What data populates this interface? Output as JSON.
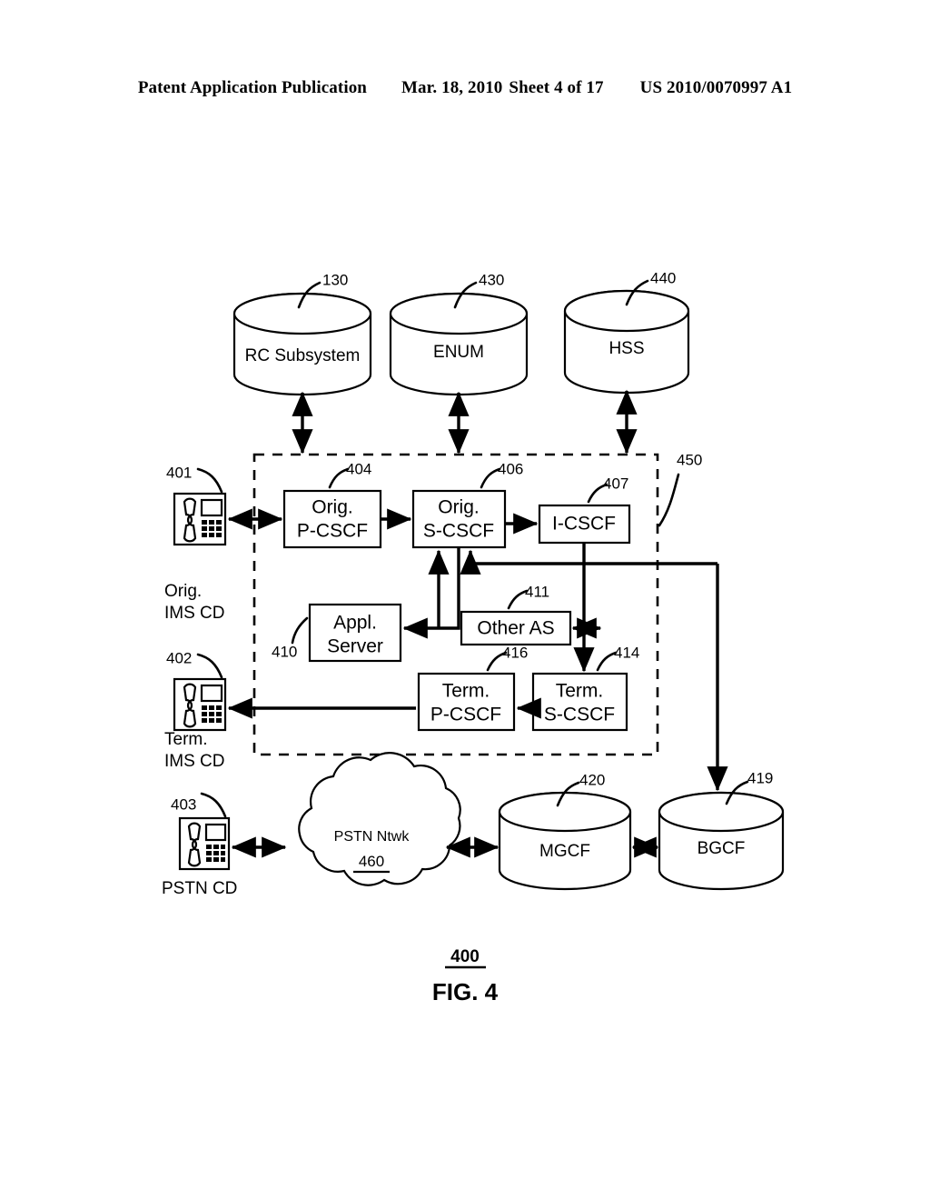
{
  "header": {
    "publication": "Patent Application Publication",
    "date": "Mar. 18, 2010",
    "sheet": "Sheet 4 of 17",
    "number": "US 2010/0070997 A1"
  },
  "figure": {
    "caption": "FIG. 4",
    "figure_ref": "400"
  },
  "databases": [
    {
      "label": "RC Subsystem",
      "ref": "130"
    },
    {
      "label": "ENUM",
      "ref": "430"
    },
    {
      "label": "HSS",
      "ref": "440"
    }
  ],
  "ims_boundary": {
    "ref": "450"
  },
  "nodes": [
    {
      "id": "orig-p-cscf",
      "line1": "Orig.",
      "line2": "P-CSCF",
      "ref": "404"
    },
    {
      "id": "orig-s-cscf",
      "line1": "Orig.",
      "line2": "S-CSCF",
      "ref": "406"
    },
    {
      "id": "i-cscf",
      "line1": "I-CSCF",
      "line2": "",
      "ref": "407"
    },
    {
      "id": "appl-server",
      "line1": "Appl.",
      "line2": "Server",
      "ref": "410"
    },
    {
      "id": "other-as",
      "line1": "Other AS",
      "line2": "",
      "ref": "411"
    },
    {
      "id": "term-p-cscf",
      "line1": "Term.",
      "line2": "P-CSCF",
      "ref": "416"
    },
    {
      "id": "term-s-cscf",
      "line1": "Term.",
      "line2": "S-CSCF",
      "ref": "414"
    }
  ],
  "endpoints": [
    {
      "id": "orig-ims-cd",
      "ref": "401",
      "label_line1": "Orig.",
      "label_line2": "IMS CD"
    },
    {
      "id": "term-ims-cd",
      "ref": "402",
      "label_line1": "Term.",
      "label_line2": "IMS CD"
    },
    {
      "id": "pstn-cd",
      "ref": "403",
      "label_line1": "PSTN CD",
      "label_line2": ""
    }
  ],
  "network_cloud": {
    "label": "PSTN Ntwk",
    "ref": "460"
  },
  "gateways": [
    {
      "label": "MGCF",
      "ref": "420"
    },
    {
      "label": "BGCF",
      "ref": "419"
    }
  ]
}
